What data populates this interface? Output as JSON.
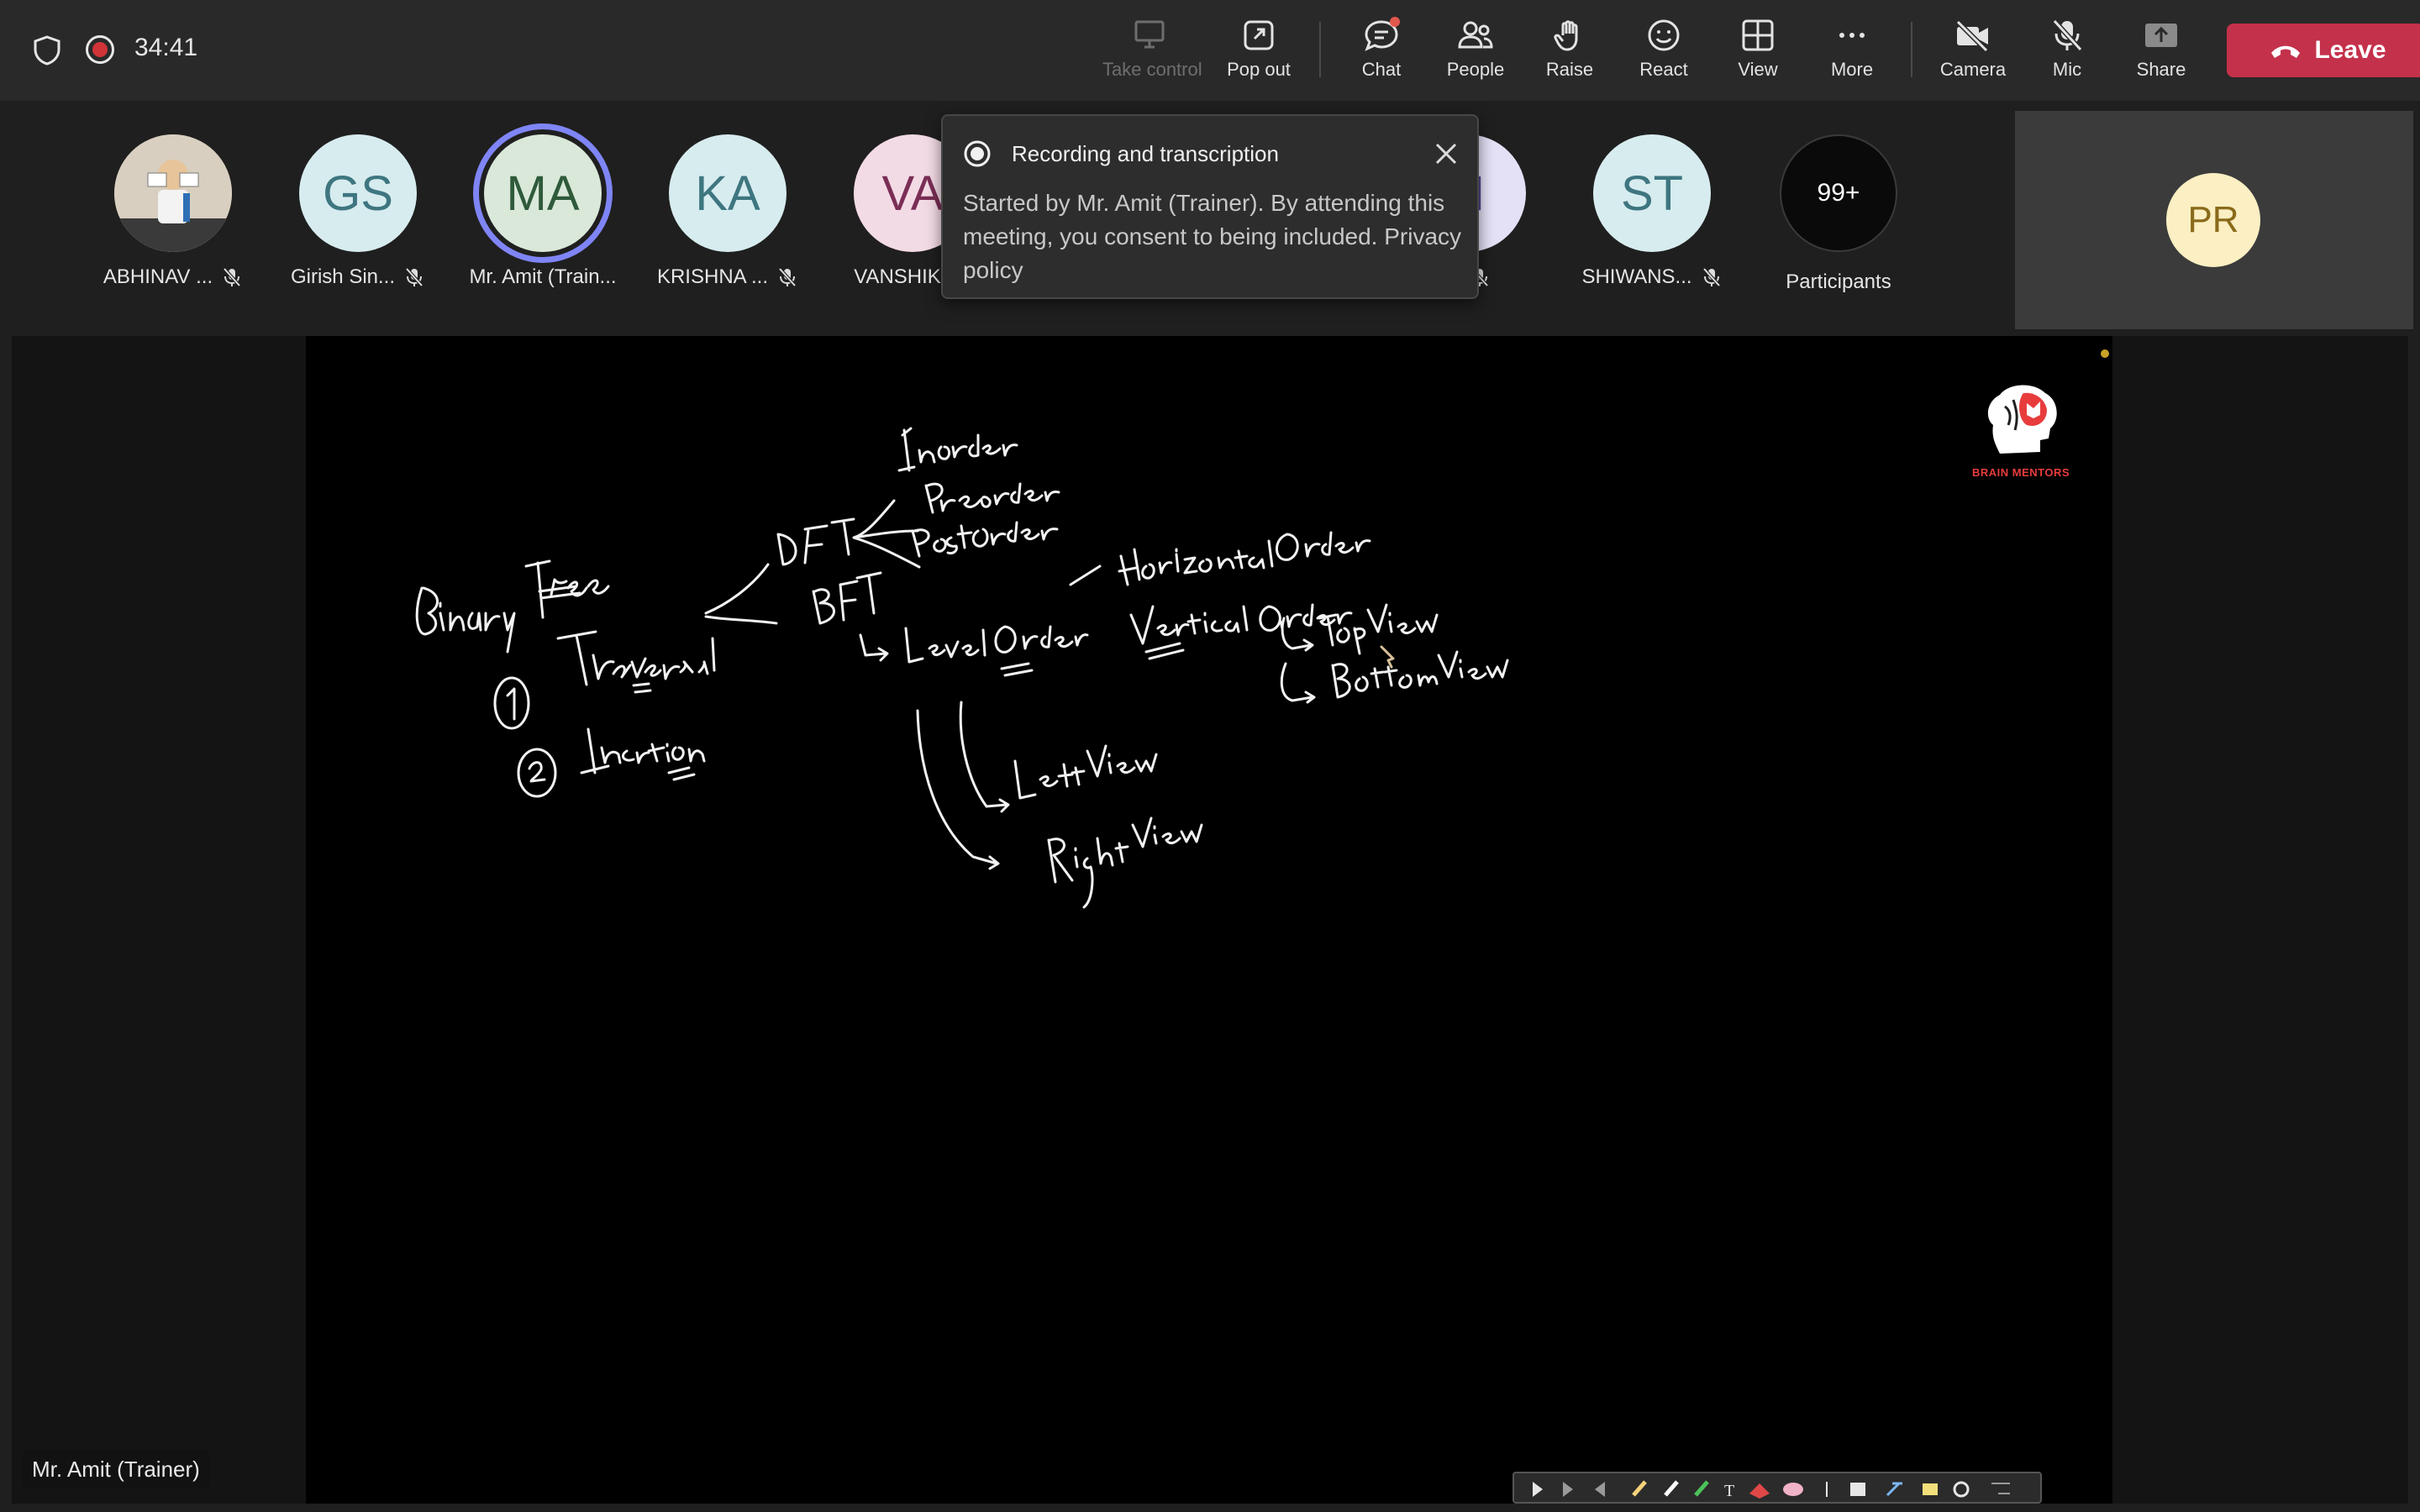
{
  "status": {
    "elapsed": "34:41"
  },
  "toolbar": {
    "take_control": "Take control",
    "pop_out": "Pop out",
    "chat": "Chat",
    "people": "People",
    "raise": "Raise",
    "react": "React",
    "view": "View",
    "more": "More",
    "camera": "Camera",
    "mic": "Mic",
    "share": "Share",
    "leave": "Leave"
  },
  "participants": [
    {
      "name": "ABHINAV ...",
      "initials": "",
      "muted": true
    },
    {
      "name": "Girish Sin...",
      "initials": "GS",
      "muted": true
    },
    {
      "name": "Mr. Amit (Train...",
      "initials": "MA",
      "muted": false,
      "speaking": true
    },
    {
      "name": "KRISHNA ...",
      "initials": "KA",
      "muted": true
    },
    {
      "name": "VANSHIKA...",
      "initials": "VA",
      "muted": false
    },
    {
      "name": "...",
      "initials": "H",
      "muted": true
    },
    {
      "name": "SHIWANS...",
      "initials": "ST",
      "muted": true
    }
  ],
  "overflow": {
    "count": "99+",
    "label": "Participants"
  },
  "self_view": {
    "initials": "PR"
  },
  "toast": {
    "title": "Recording and transcription",
    "body": "Started by Mr. Amit (Trainer). By attending this meeting, you consent to being included.",
    "link": "Privacy policy"
  },
  "whiteboard": {
    "logo_text": "BRAIN MENTORS",
    "notes": [
      "Binary Tree",
      "Traversal",
      "1",
      "Insertion",
      "2",
      "DFT",
      "Inorder",
      "Preorder",
      "PostOrder",
      "BFT",
      "Level Order",
      "HorizontalOrder",
      "Vertical Order",
      "TopView",
      "BottomView",
      "LeftView",
      "RightView"
    ]
  },
  "presenter": {
    "label": "Mr. Amit (Trainer)"
  },
  "colors": {
    "leave": "#c4314b",
    "speaking_ring": "#7f85f5",
    "recording": "#d13438",
    "logo": "#e83c3c"
  }
}
